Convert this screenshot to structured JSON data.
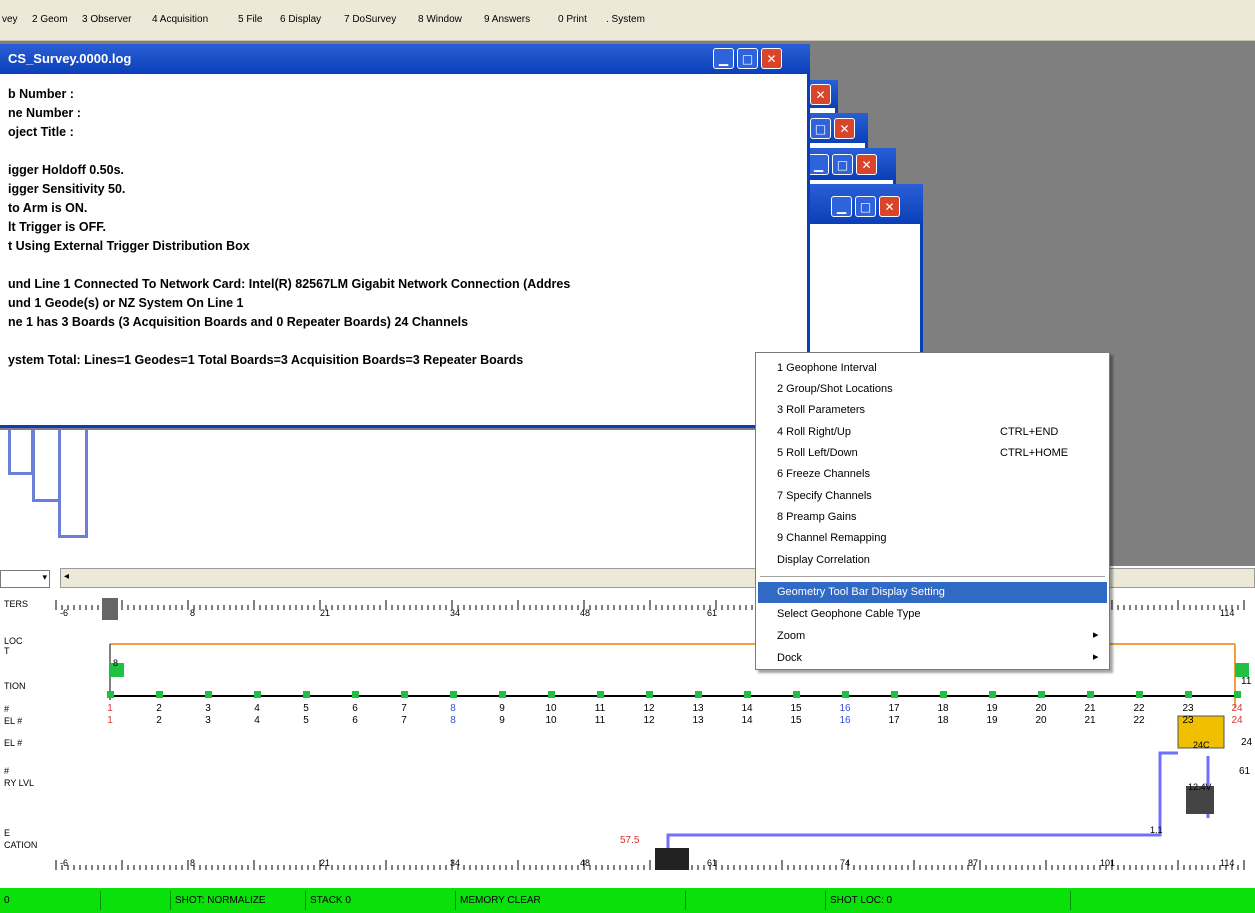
{
  "menu": [
    "vey",
    "2 Geom",
    "3 Observer",
    "4 Acquisition",
    "5 File",
    "6 Display",
    "7 DoSurvey",
    "8 Window",
    "9 Answers",
    "0 Print",
    ". System"
  ],
  "log_window": {
    "title": "CS_Survey.0000.log",
    "lines": [
      "b Number :",
      "ne Number :",
      "oject Title :",
      "",
      "igger Holdoff 0.50s.",
      "igger Sensitivity 50.",
      "to Arm is ON.",
      "lt Trigger is OFF.",
      "t Using External Trigger Distribution Box",
      "",
      "und Line 1 Connected To Network Card: Intel(R) 82567LM Gigabit Network Connection  (Addres",
      "und 1 Geode(s) or NZ System On Line 1",
      "ne 1 has 3 Boards (3 Acquisition Boards and 0 Repeater Boards) 24 Channels",
      "",
      "ystem Total: Lines=1  Geodes=1  Total Boards=3  Acquisition Boards=3  Repeater Boards"
    ]
  },
  "window_buttons": {
    "minimize": "▁",
    "maximize": "□",
    "close": "✕"
  },
  "context_menu": {
    "items": [
      {
        "label": "1 Geophone Interval",
        "shortcut": ""
      },
      {
        "label": "2 Group/Shot Locations",
        "shortcut": ""
      },
      {
        "label": "3 Roll Parameters",
        "shortcut": ""
      },
      {
        "label": "4 Roll Right/Up",
        "shortcut": "CTRL+END"
      },
      {
        "label": "5 Roll Left/Down",
        "shortcut": "CTRL+HOME"
      },
      {
        "label": "6 Freeze Channels",
        "shortcut": ""
      },
      {
        "label": "7 Specify Channels",
        "shortcut": ""
      },
      {
        "label": "8 Preamp Gains",
        "shortcut": ""
      },
      {
        "label": "9 Channel Remapping",
        "shortcut": ""
      },
      {
        "label": "Display Correlation",
        "shortcut": ""
      }
    ],
    "items2": [
      {
        "label": "Geometry Tool Bar Display Setting",
        "highlighted": true
      },
      {
        "label": "Select Geophone Cable Type"
      },
      {
        "label": "Zoom",
        "submenu": true
      },
      {
        "label": "Dock",
        "submenu": true
      }
    ],
    "submenu_arrow": "▸"
  },
  "geometry": {
    "row_labels": [
      "TERS",
      "LOC",
      "T",
      "TION",
      "#",
      "EL #",
      "EL #",
      "#",
      "RY LVL",
      "E",
      "CATION"
    ],
    "ruler_top": [
      "-6",
      "8",
      "21",
      "34",
      "48",
      "61",
      "114"
    ],
    "ruler_bottom": [
      "-6",
      "8",
      "21",
      "34",
      "48",
      "61",
      "74",
      "87",
      "101",
      "114"
    ],
    "channels": [
      "1",
      "2",
      "3",
      "4",
      "5",
      "6",
      "7",
      "8",
      "9",
      "10",
      "11",
      "12",
      "13",
      "14",
      "15",
      "16",
      "17",
      "18",
      "19",
      "20",
      "21",
      "22",
      "23",
      "24"
    ],
    "shot_offset": "0",
    "shot_marker": "8",
    "laptop_label": "57.5",
    "right_labels": {
      "top": "11",
      "mid": "24",
      "b": "1",
      "r": "61",
      "box": "24C",
      "side": "1.1",
      "dev": "12.4V"
    }
  },
  "status": {
    "cells": [
      "0",
      "",
      "SHOT: NORMALIZE",
      "STACK 0",
      "MEMORY CLEAR",
      "",
      "SHOT LOC: 0",
      ""
    ]
  },
  "colors": {
    "accent": "#0a3fb8",
    "status_green": "#0ae00a",
    "highlight": "#316ac5",
    "cable_orange": "#f0a040",
    "cable_blue": "#7070ff",
    "geophone_green": "#20c040"
  }
}
